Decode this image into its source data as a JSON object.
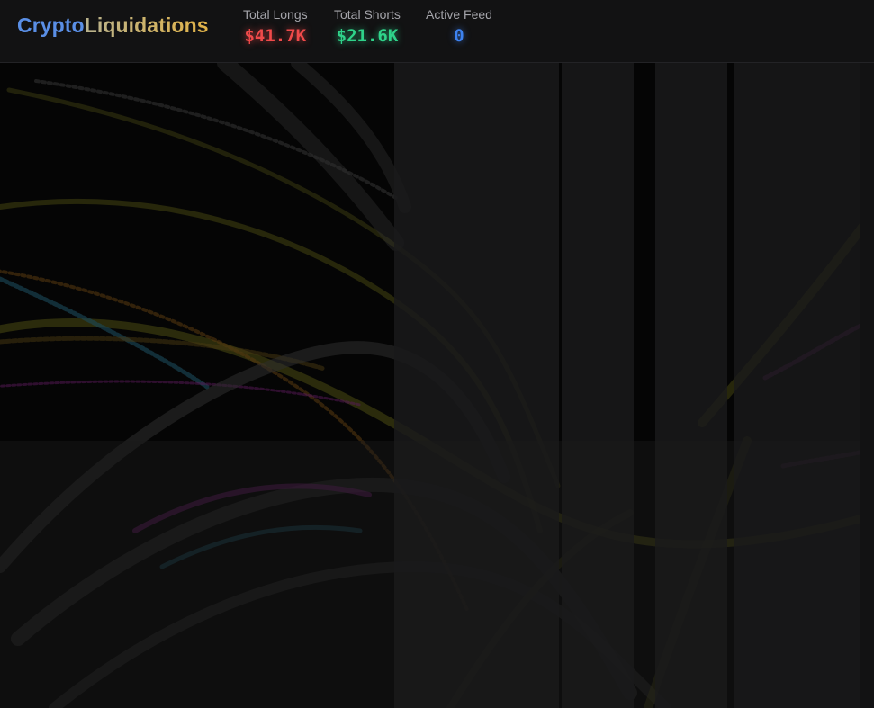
{
  "logo": {
    "part1": "Crypto",
    "part2": "Liquidations"
  },
  "stats": {
    "longs": {
      "label": "Total Longs",
      "value": "$41.7K",
      "color": "#f04a4a"
    },
    "shorts": {
      "label": "Total Shorts",
      "value": "$21.6K",
      "color": "#2fd38a"
    },
    "feed": {
      "label": "Active Feed",
      "value": "0",
      "color": "#3d82f0"
    }
  },
  "colors": {
    "background": "#0b0b0c",
    "header": "#121213",
    "stream_yellow": "#4a4a10",
    "stream_gray": "#3a3a3a",
    "stream_magenta": "#5a1a5a",
    "stream_cyan": "#1a4a5a",
    "stream_orange": "#5a3a10"
  }
}
